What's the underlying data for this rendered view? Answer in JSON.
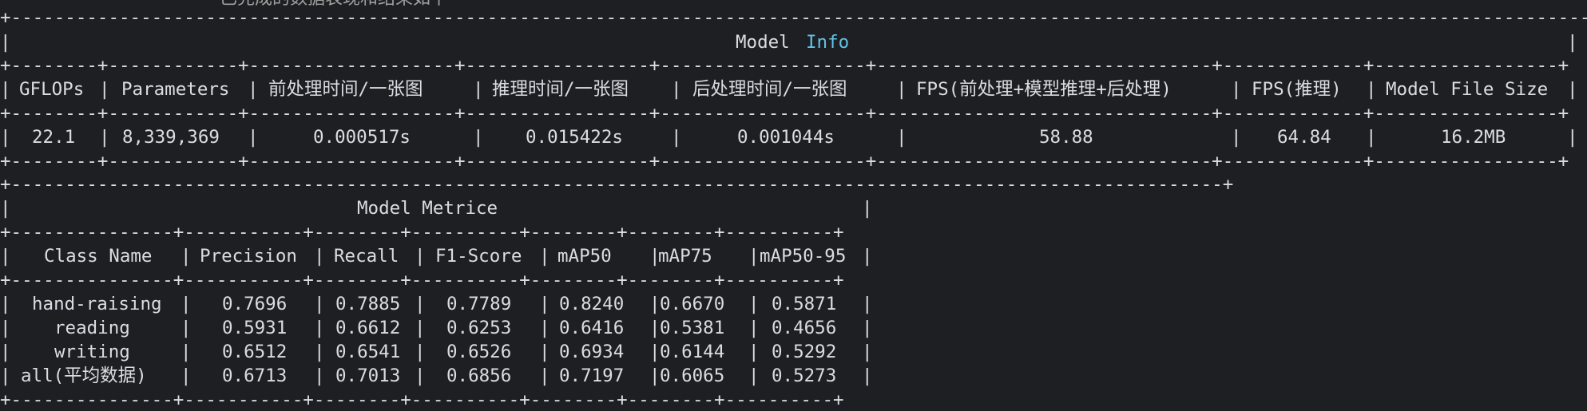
{
  "top_partial_text": "已完成的数据表现和结果如下",
  "model_info": {
    "title_word1": "Model",
    "title_word2": "Info",
    "headers": [
      "GFLOPs",
      "Parameters",
      "前处理时间/一张图",
      "推理时间/一张图",
      "后处理时间/一张图",
      "FPS(前处理+模型推理+后处理)",
      "FPS(推理)",
      "Model File Size"
    ],
    "values": [
      "22.1",
      "8,339,369",
      "0.000517s",
      "0.015422s",
      "0.001044s",
      "58.88",
      "64.84",
      "16.2MB"
    ]
  },
  "model_metric": {
    "title": "Model Metrice",
    "headers": [
      "Class Name",
      "Precision",
      "Recall",
      "F1-Score",
      "mAP50",
      "mAP75",
      "mAP50-95"
    ],
    "rows": [
      [
        "hand-raising",
        "0.7696",
        "0.7885",
        "0.7789",
        "0.8240",
        "0.6670",
        "0.5871"
      ],
      [
        "reading",
        "0.5931",
        "0.6612",
        "0.6253",
        "0.6416",
        "0.5381",
        "0.4656"
      ],
      [
        "writing",
        "0.6512",
        "0.6541",
        "0.6526",
        "0.6934",
        "0.6144",
        "0.5292"
      ],
      [
        "all(平均数据)",
        "0.6713",
        "0.7013",
        "0.6856",
        "0.7197",
        "0.6065",
        "0.5273"
      ]
    ]
  }
}
